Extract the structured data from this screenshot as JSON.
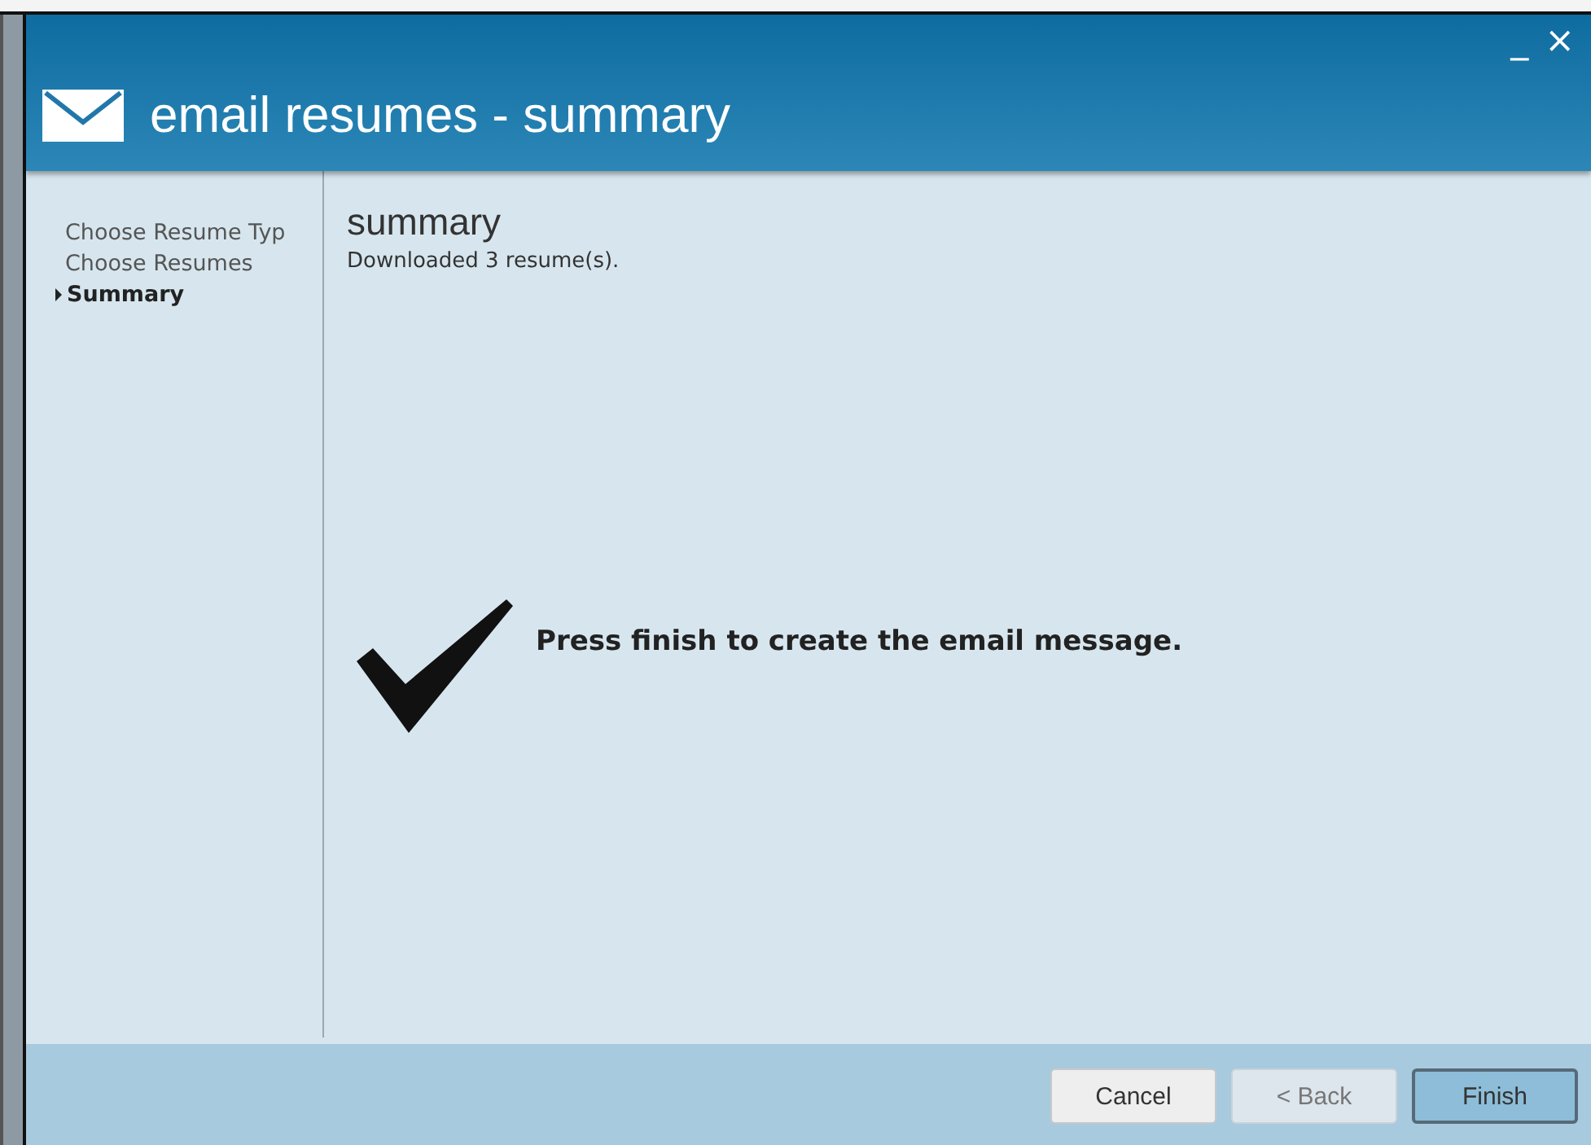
{
  "window": {
    "title": "email resumes - summary",
    "controls": [
      "_",
      "×"
    ]
  },
  "steps": [
    {
      "label": "Choose Resume Typ",
      "selected": false
    },
    {
      "label": "Choose Resumes",
      "selected": false
    },
    {
      "label": "Summary",
      "selected": true
    }
  ],
  "content": {
    "heading": "summary",
    "status": "Downloaded 3 resume(s).",
    "message": "Press finish to create the email message."
  },
  "buttons": [
    {
      "label": "Cancel",
      "kind": "cancel",
      "disabled": false
    },
    {
      "label": "< Back",
      "kind": "back",
      "disabled": true
    },
    {
      "label": "Finish",
      "kind": "primary",
      "disabled": false
    }
  ]
}
